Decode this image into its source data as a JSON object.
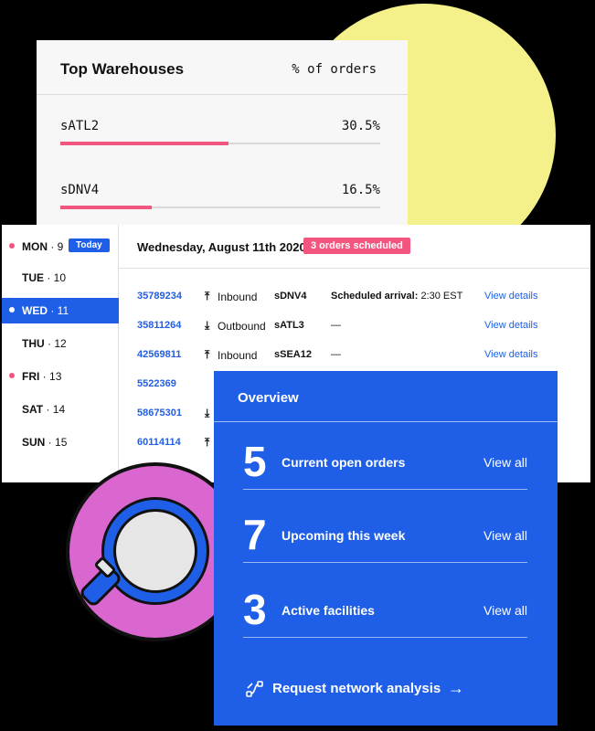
{
  "warehouses": {
    "title": "Top Warehouses",
    "column": "% of orders",
    "rows": [
      {
        "name": "sATL2",
        "percent": "30.5%",
        "share": 0.305
      },
      {
        "name": "sDNV4",
        "percent": "16.5%",
        "share": 0.165
      }
    ]
  },
  "calendar": {
    "today_label": "Today",
    "days": [
      {
        "dow": "MON",
        "num": "9",
        "has_orders": true,
        "today": true,
        "selected": false
      },
      {
        "dow": "TUE",
        "num": "10",
        "has_orders": false,
        "today": false,
        "selected": false
      },
      {
        "dow": "WED",
        "num": "11",
        "has_orders": true,
        "today": false,
        "selected": true
      },
      {
        "dow": "THU",
        "num": "12",
        "has_orders": false,
        "today": false,
        "selected": false
      },
      {
        "dow": "FRI",
        "num": "13",
        "has_orders": true,
        "today": false,
        "selected": false
      },
      {
        "dow": "SAT",
        "num": "14",
        "has_orders": false,
        "today": false,
        "selected": false
      },
      {
        "dow": "SUN",
        "num": "15",
        "has_orders": false,
        "today": false,
        "selected": false
      }
    ]
  },
  "orders": {
    "date": "Wednesday, August 11th 2020",
    "badge": "3 orders scheduled",
    "rows": [
      {
        "id": "35789234",
        "direction": "Inbound",
        "direction_icon": "arrow-up-to-line-icon",
        "facility": "sDNV4",
        "schedule_label": "Scheduled arrival:",
        "schedule_value": "2:30 EST",
        "link": "View details"
      },
      {
        "id": "35811264",
        "direction": "Outbound",
        "direction_icon": "arrow-down-to-line-icon",
        "facility": "sATL3",
        "schedule_label": "",
        "schedule_value": "—",
        "link": "View details"
      },
      {
        "id": "42569811",
        "direction": "Inbound",
        "direction_icon": "arrow-up-to-line-icon",
        "facility": "sSEA12",
        "schedule_label": "",
        "schedule_value": "—",
        "link": "View details"
      },
      {
        "id": "5522369",
        "direction": "",
        "direction_icon": "",
        "facility": "",
        "schedule_label": "",
        "schedule_value": "",
        "link": ""
      },
      {
        "id": "58675301",
        "direction": "",
        "direction_icon": "arrow-down-to-line-icon",
        "facility": "",
        "schedule_label": "",
        "schedule_value": "",
        "link": ""
      },
      {
        "id": "60114114",
        "direction": "",
        "direction_icon": "arrow-up-to-line-icon",
        "facility": "",
        "schedule_label": "",
        "schedule_value": "",
        "link": ""
      }
    ]
  },
  "overview": {
    "title": "Overview",
    "items": [
      {
        "count": "5",
        "label": "Current open orders",
        "link": "View all"
      },
      {
        "count": "7",
        "label": "Upcoming this week",
        "link": "View all"
      },
      {
        "count": "3",
        "label": "Active facilities",
        "link": "View all"
      }
    ],
    "cta": "Request network analysis",
    "cta_icon": "network-analysis-icon",
    "cta_arrow": "→"
  },
  "colors": {
    "accent_blue": "#1f5fe8",
    "accent_pink": "#f2557d",
    "yellow": "#f4f08a",
    "magenta": "#d967cf"
  }
}
